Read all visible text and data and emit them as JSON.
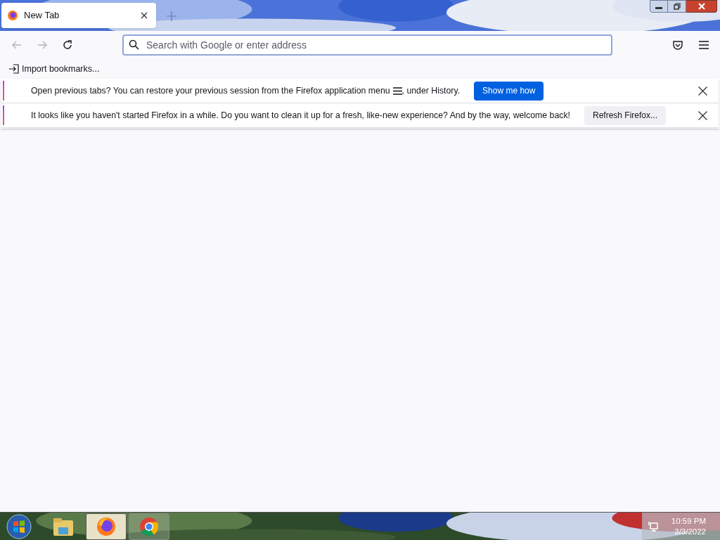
{
  "tabs": [
    {
      "title": "New Tab",
      "selected": true
    }
  ],
  "address_bar": {
    "placeholder": "Search with Google or enter address"
  },
  "nav": {
    "back_disabled": true,
    "forward_disabled": true
  },
  "bookmarks_bar": {
    "import_label": "Import bookmarks..."
  },
  "notifications": [
    {
      "kind": "session",
      "message_before": "Open previous tabs? You can restore your previous session from the Firefox application menu",
      "message_after": ", under History.",
      "button": "Show me how",
      "primary": true
    },
    {
      "kind": "refresh",
      "message_before": "It looks like you haven't started Firefox in a while. Do you want to clean it up for a fresh, like-new experience? And by the way, welcome back!",
      "button": "Refresh Firefox...",
      "primary": false
    }
  ],
  "taskbar": {
    "items": [
      {
        "kind": "explorer",
        "active": false
      },
      {
        "kind": "firefox",
        "active": true
      },
      {
        "kind": "chrome",
        "active": false
      }
    ],
    "time": "10:59 PM",
    "date": "3/3/2022"
  }
}
